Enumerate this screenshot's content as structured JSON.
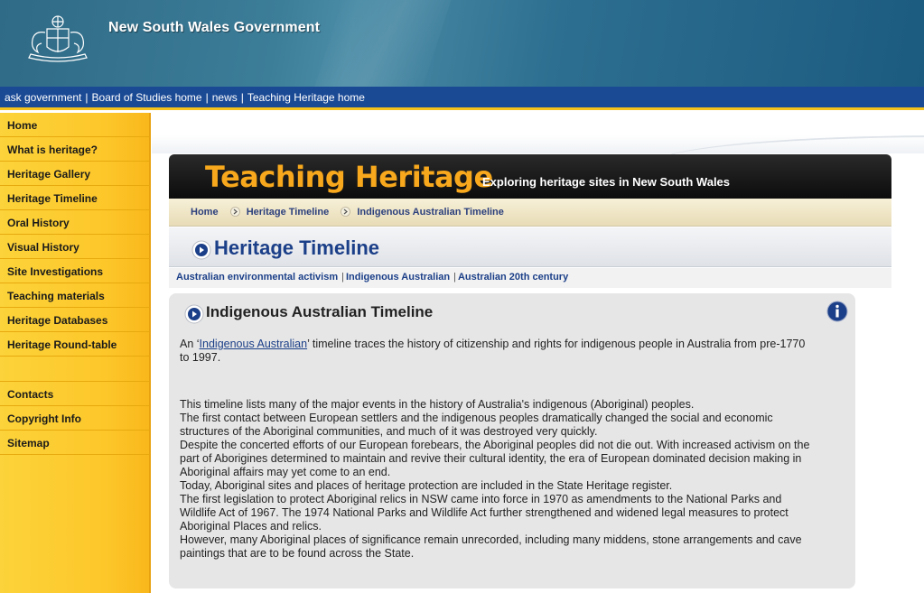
{
  "header": {
    "title": "New South Wales Government",
    "crest_icon": "nsw-coat-of-arms-icon"
  },
  "topnav": {
    "items": [
      "ask government",
      "Board of Studies home",
      "news",
      "Teaching Heritage home"
    ],
    "separator": "|"
  },
  "sidebar": {
    "items": [
      "Home",
      "What is heritage?",
      "Heritage Gallery",
      "Heritage Timeline",
      "Oral History",
      "Visual History",
      "Site Investigations",
      "Teaching materials",
      "Heritage Databases",
      "Heritage Round-table"
    ],
    "secondary_items": [
      "Contacts",
      "Copyright Info",
      "Sitemap"
    ]
  },
  "banner": {
    "title": "Teaching Heritage",
    "subtitle": "Exploring heritage sites in New South Wales"
  },
  "breadcrumb": [
    "Home",
    "Heritage Timeline",
    "Indigenous Australian Timeline"
  ],
  "section": {
    "title": "Heritage Timeline"
  },
  "subtabs": [
    "Australian environmental activism",
    "Indigenous Australian",
    "Australian 20th century"
  ],
  "panel": {
    "title": "Indigenous Australian Timeline",
    "intro_prefix": "An ‘",
    "intro_link": "Indigenous Australian",
    "intro_suffix": "’ timeline traces the history of citizenship and rights for indigenous people in Australia from pre-1770 to 1997.",
    "paragraphs": [
      "This timeline lists many of the major events in the history of Australia's indigenous (Aboriginal) peoples.",
      "The first contact between European settlers and the indigenous peoples dramatically changed the social and economic structures of the Aboriginal communities, and much of it was destroyed very quickly.",
      "Despite the concerted efforts of our European forebears, the Aboriginal peoples did not die out. With increased activism on the part of Aborigines determined to maintain and revive their cultural identity, the era of European dominated decision making in Aboriginal affairs may yet come to an end.",
      "Today, Aboriginal sites and places of heritage protection are included in the State Heritage register.",
      "The first legislation to protect Aboriginal relics in NSW came into force in 1970 as amendments to the National Parks and Wildlife Act of 1967. The 1974 National Parks and Wildlife Act further strengthened and widened legal measures to protect Aboriginal Places and relics.",
      "However, many Aboriginal places of significance remain unrecorded, including many middens, stone arrangements and cave paintings that are to be found across the State."
    ]
  },
  "colors": {
    "nav_blue": "#1b4a95",
    "sidebar_yellow": "#fdc72a",
    "banner_orange": "#f7a81c",
    "heading_blue": "#1b3f88"
  }
}
